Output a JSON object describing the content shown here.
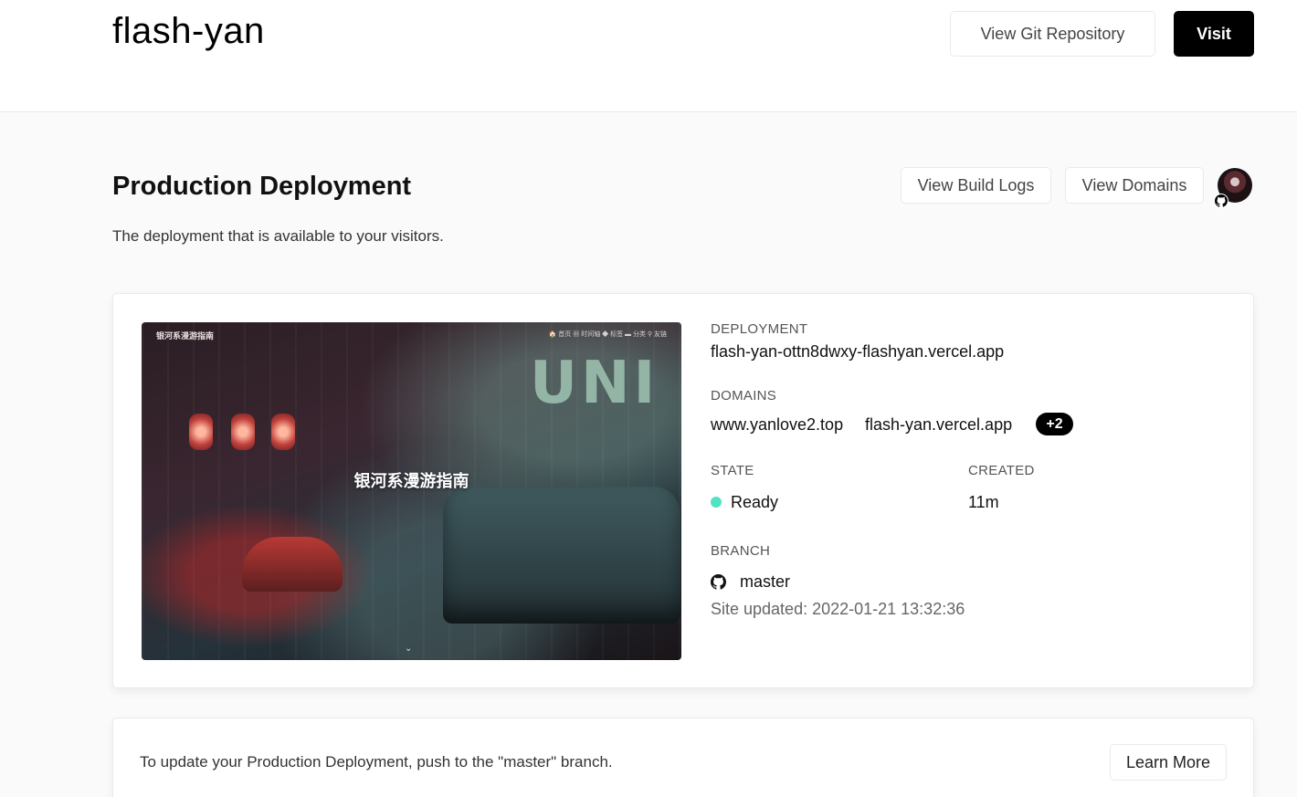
{
  "header": {
    "project_name": "flash-yan",
    "git_button": "View Git Repository",
    "visit_button": "Visit"
  },
  "production": {
    "title": "Production Deployment",
    "subtitle": "The deployment that is available to your visitors.",
    "build_logs_button": "View Build Logs",
    "domains_button": "View Domains"
  },
  "preview": {
    "brand": "银河系漫游指南",
    "nav": "🏠 首页  ▦ 时间轴  ◆ 标签  ▬ 分类  ⚲ 友链",
    "center_title": "银河系漫游指南",
    "sign": "UNI"
  },
  "deployment": {
    "deployment_label": "DEPLOYMENT",
    "deployment_url": "flash-yan-ottn8dwxy-flashyan.vercel.app",
    "domains_label": "DOMAINS",
    "domains": [
      "www.yanlove2.top",
      "flash-yan.vercel.app"
    ],
    "more_domains": "+2",
    "state_label": "STATE",
    "state": "Ready",
    "state_color": "#50e3c2",
    "created_label": "CREATED",
    "created": "11m",
    "branch_label": "BRANCH",
    "branch": "master",
    "branch_icon": "github-icon",
    "site_updated": "Site updated: 2022-01-21 13:32:36"
  },
  "footer_card": {
    "hint": "To update your Production Deployment, push to the \"master\" branch.",
    "learn_more": "Learn More"
  }
}
